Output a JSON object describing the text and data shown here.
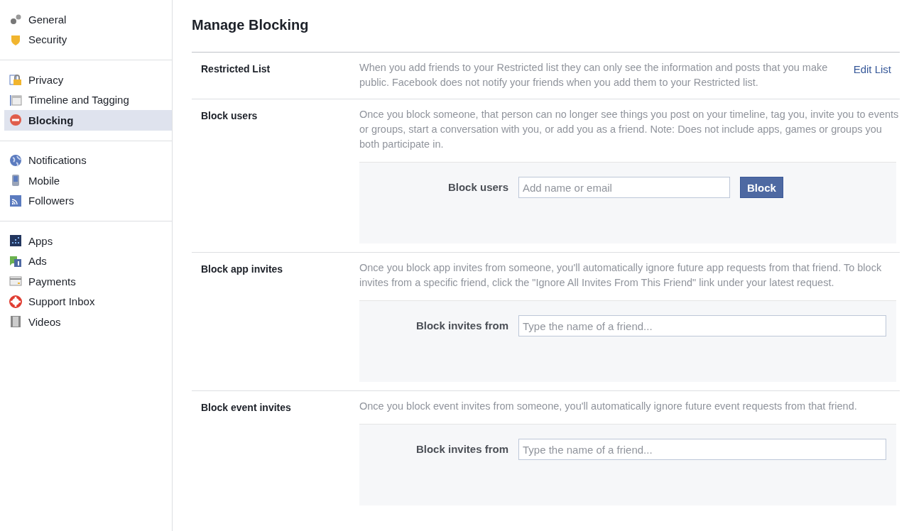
{
  "sidebar": {
    "groups": [
      {
        "items": [
          {
            "label": "General",
            "selected": false
          },
          {
            "label": "Security",
            "selected": false
          }
        ]
      },
      {
        "items": [
          {
            "label": "Privacy",
            "selected": false
          },
          {
            "label": "Timeline and Tagging",
            "selected": false
          },
          {
            "label": "Blocking",
            "selected": true
          }
        ]
      },
      {
        "items": [
          {
            "label": "Notifications",
            "selected": false
          },
          {
            "label": "Mobile",
            "selected": false
          },
          {
            "label": "Followers",
            "selected": false
          }
        ]
      },
      {
        "items": [
          {
            "label": "Apps",
            "selected": false
          },
          {
            "label": "Ads",
            "selected": false
          },
          {
            "label": "Payments",
            "selected": false
          },
          {
            "label": "Support Inbox",
            "selected": false
          },
          {
            "label": "Videos",
            "selected": false
          }
        ]
      }
    ]
  },
  "page_title": "Manage Blocking",
  "sections": [
    {
      "title": "Restricted List",
      "description": "When you add friends to your Restricted list they can only see the information and posts that you make public. Facebook does not notify your friends when you add them to your Restricted list.",
      "link": "Edit List"
    },
    {
      "title": "Block users",
      "description": "Once you block someone, that person can no longer see things you post on your timeline, tag you, invite you to events or groups, start a conversation with you, or add you as a friend. Note: Does not include apps, games or groups you both participate in.",
      "form": {
        "label": "Block users",
        "placeholder": "Add name or email",
        "button": "Block"
      }
    },
    {
      "title": "Block app invites",
      "description": "Once you block app invites from someone, you'll automatically ignore future app requests from that friend. To block invites from a specific friend, click the \"Ignore All Invites From This Friend\" link under your latest request.",
      "form": {
        "label": "Block invites from",
        "placeholder": "Type the name of a friend..."
      }
    },
    {
      "title": "Block event invites",
      "description": "Once you block event invites from someone, you'll automatically ignore future event requests from that friend.",
      "form": {
        "label": "Block invites from",
        "placeholder": "Type the name of a friend..."
      }
    }
  ]
}
